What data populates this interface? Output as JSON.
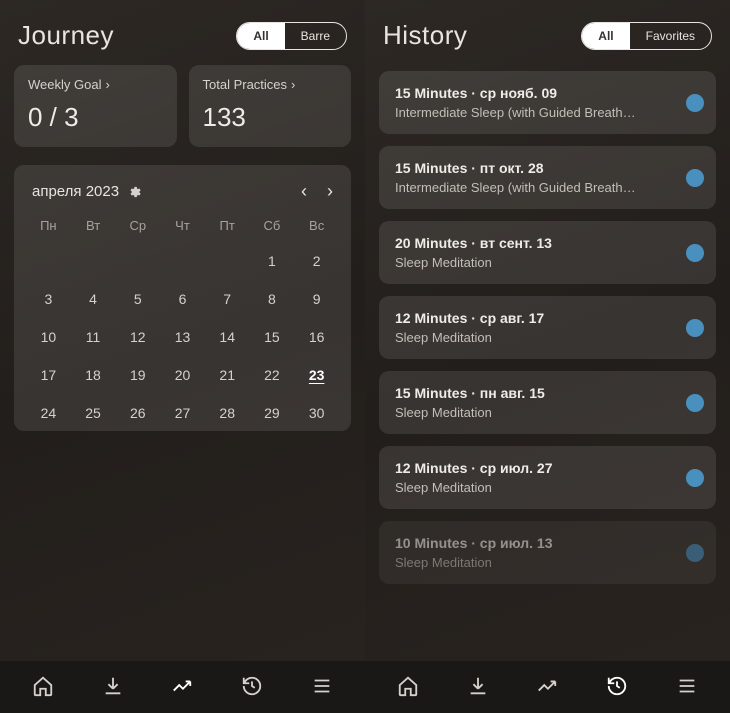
{
  "journey": {
    "title": "Journey",
    "segments": {
      "a": "All",
      "b": "Barre"
    },
    "stats": {
      "goal_label": "Weekly Goal",
      "goal_value": "0 / 3",
      "practices_label": "Total Practices",
      "practices_value": "133"
    },
    "calendar": {
      "month_label": "апреля 2023",
      "dow": [
        "Пн",
        "Вт",
        "Ср",
        "Чт",
        "Пт",
        "Сб",
        "Вс"
      ],
      "today": 23,
      "lead_blanks": 5,
      "last_day": 30
    }
  },
  "history": {
    "title": "History",
    "segments": {
      "a": "All",
      "b": "Favorites"
    },
    "items": [
      {
        "title": "15 Minutes · ср нояб. 09",
        "subtitle": "Intermediate Sleep (with Guided Breath…"
      },
      {
        "title": "15 Minutes · пт окт. 28",
        "subtitle": "Intermediate Sleep (with Guided Breath…"
      },
      {
        "title": "20 Minutes · вт сент. 13",
        "subtitle": "Sleep Meditation"
      },
      {
        "title": "12 Minutes · ср авг. 17",
        "subtitle": "Sleep Meditation"
      },
      {
        "title": "15 Minutes · пн авг. 15",
        "subtitle": "Sleep Meditation"
      },
      {
        "title": "12 Minutes · ср июл. 27",
        "subtitle": "Sleep Meditation"
      },
      {
        "title": "10 Minutes · ср июл. 13",
        "subtitle": "Sleep Meditation"
      }
    ]
  }
}
